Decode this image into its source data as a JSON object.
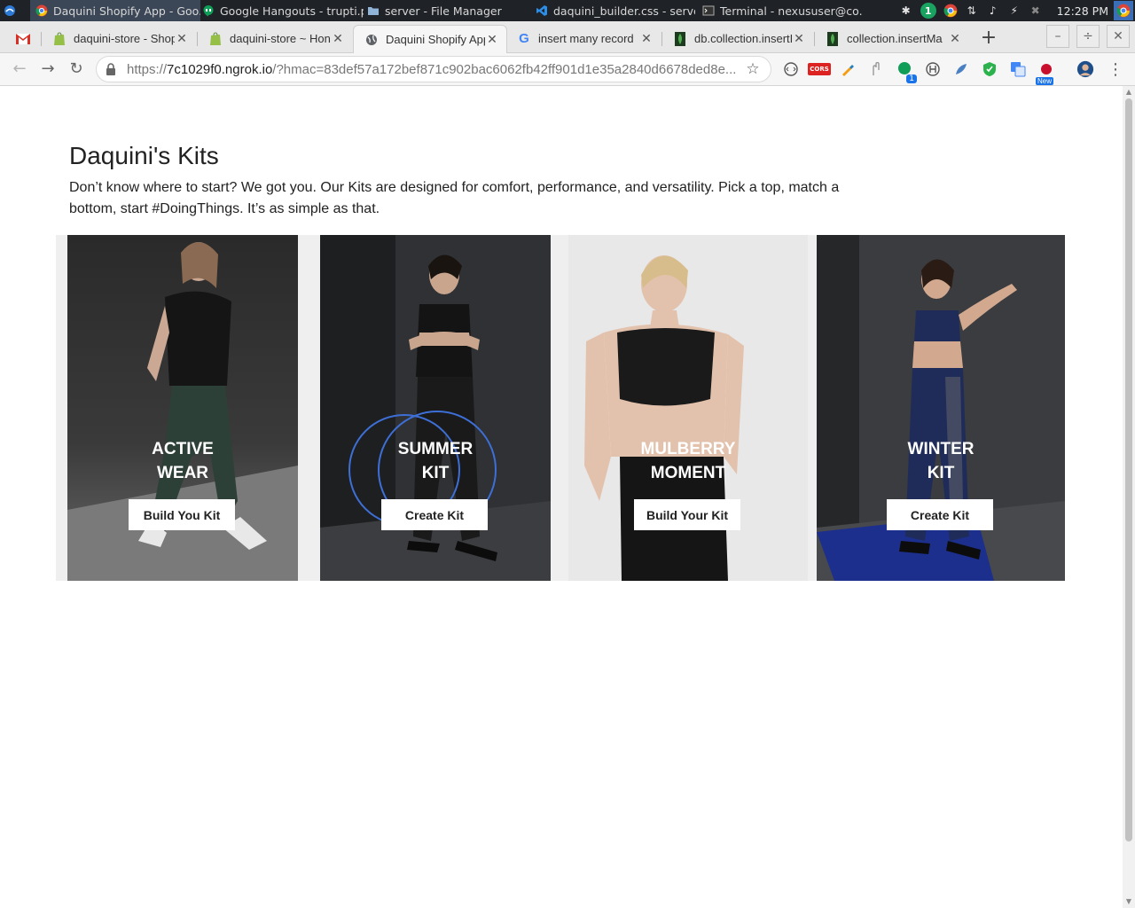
{
  "taskbar": {
    "tasks": [
      {
        "title": "Daquini Shopify App - Goo..."
      },
      {
        "title": "Google Hangouts - trupti.p..."
      },
      {
        "title": "server - File Manager"
      },
      {
        "title": "daquini_builder.css - serve..."
      },
      {
        "title": "Terminal - nexususer@co..."
      }
    ],
    "clock": "12:28 PM",
    "badge": "1"
  },
  "tabs": [
    {
      "title": "daquini-store - Shop"
    },
    {
      "title": "daquini-store ~ Hon"
    },
    {
      "title": "Daquini Shopify App"
    },
    {
      "title": "insert many record"
    },
    {
      "title": "db.collection.insertI"
    },
    {
      "title": "collection.insertMa"
    }
  ],
  "address": {
    "scheme": "https://",
    "host": "7c1029f0.ngrok.io",
    "rest": "/?hmac=83def57a172bef871c902bac6062fb42ff901d1e35a2840d6678ded8e..."
  },
  "extensions": {
    "badge": "1",
    "new_label": "New",
    "cors_label": "CORS"
  },
  "page": {
    "title": "Daquini's Kits",
    "description": "Don’t know where to start? We got you. Our Kits are designed for comfort, performance, and versatility. Pick a top, match a bottom, start #DoingThings. It’s as simple as that."
  },
  "kits": [
    {
      "line1": "ACTIVE",
      "line2": "WEAR",
      "button": "Build You Kit"
    },
    {
      "line1": "SUMMER",
      "line2": "KIT",
      "button": "Create Kit"
    },
    {
      "line1": "MULBERRY",
      "line2": "MOMENT",
      "button": "Build Your Kit"
    },
    {
      "line1": "WINTER",
      "line2": "KIT",
      "button": "Create Kit"
    }
  ]
}
